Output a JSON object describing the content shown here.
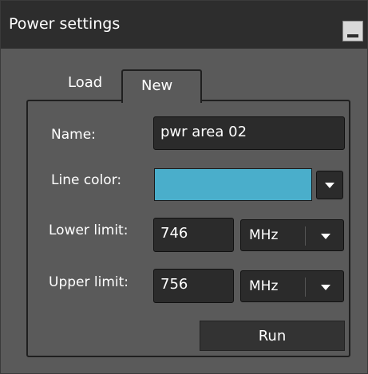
{
  "window": {
    "title": "Power settings"
  },
  "tabs": [
    {
      "label": "Load",
      "active": false
    },
    {
      "label": "New",
      "active": true
    }
  ],
  "form": {
    "name_label": "Name:",
    "name_value": "pwr area 02",
    "line_color_label": "Line color:",
    "line_color_value": "#4aaecb",
    "lower_limit_label": "Lower limit:",
    "lower_limit_value": "746",
    "lower_limit_unit": "MHz",
    "upper_limit_label": "Upper limit:",
    "upper_limit_value": "756",
    "upper_limit_unit": "MHz",
    "run_label": "Run"
  },
  "icons": {
    "minimize": "minimize-icon",
    "dropdown": "chevron-down-icon"
  }
}
